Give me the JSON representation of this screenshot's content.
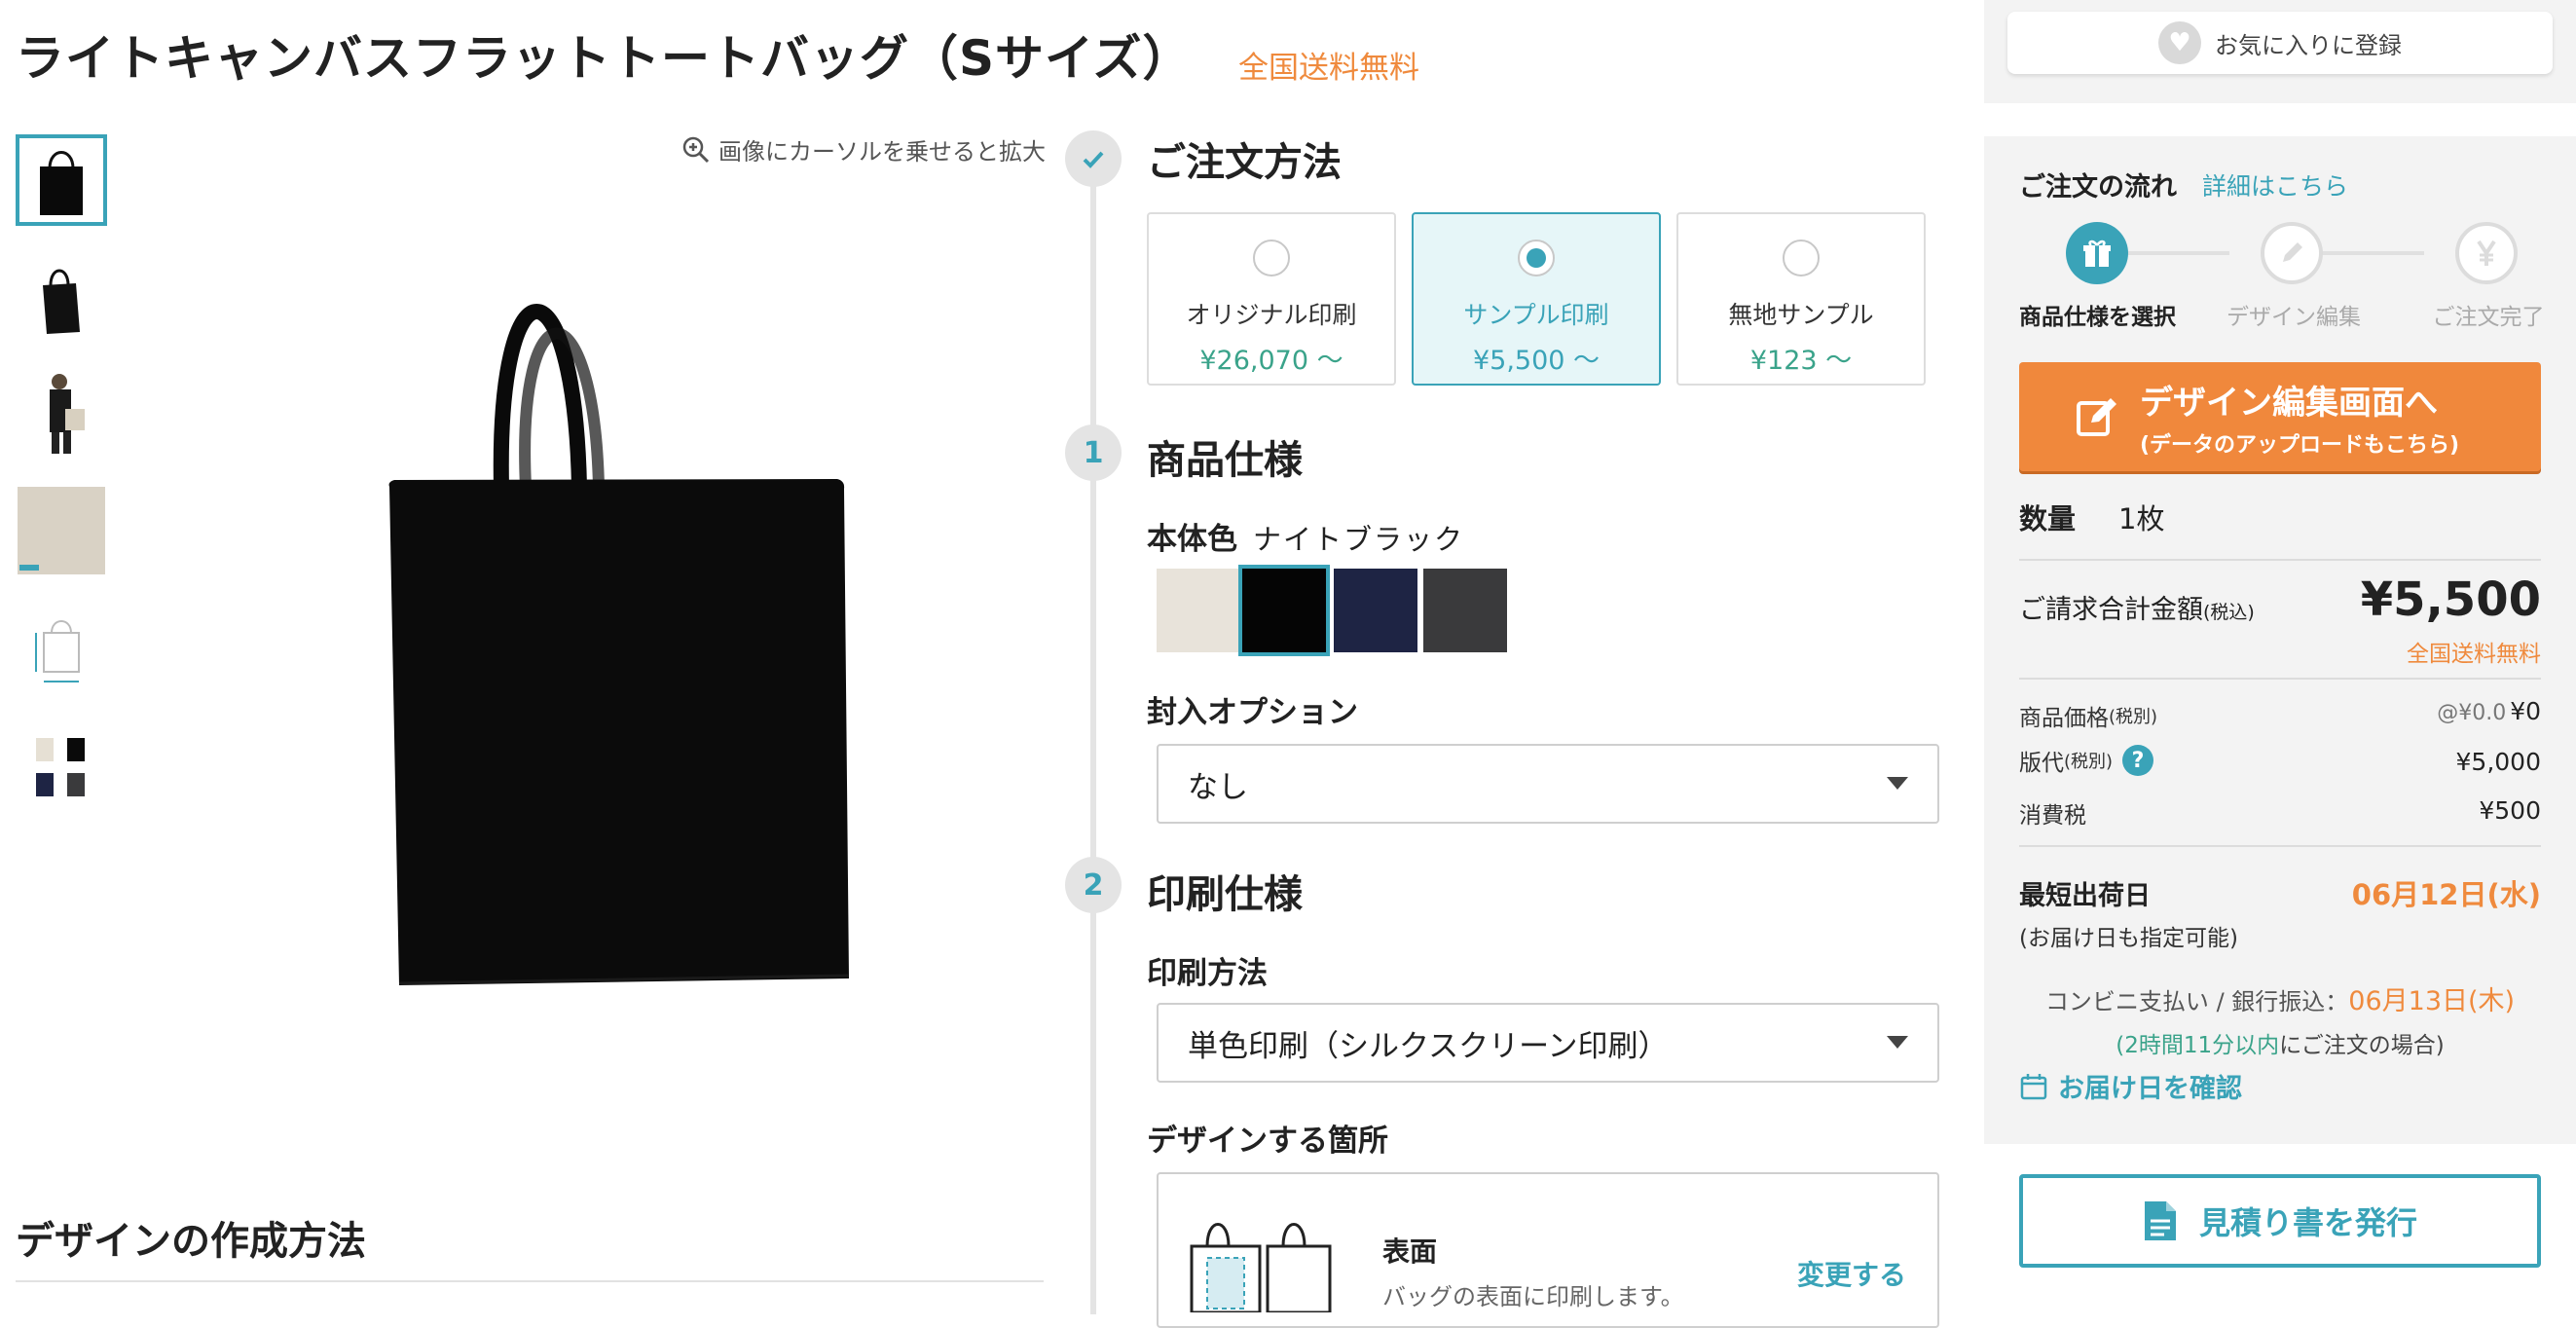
{
  "product": {
    "title": "ライトキャンバスフラットトートバッグ（Sサイズ）",
    "shipping_badge": "全国送料無料",
    "zoom_hint": "画像にカーソルを乗せると拡大",
    "design_guide_heading": "デザインの作成方法"
  },
  "order_method": {
    "title": "ご注文方法",
    "options": [
      {
        "name": "オリジナル印刷",
        "price": "¥26,070 〜",
        "selected": false
      },
      {
        "name": "サンプル印刷",
        "price": "¥5,500 〜",
        "selected": true
      },
      {
        "name": "無地サンプル",
        "price": "¥123 〜",
        "selected": false
      }
    ]
  },
  "spec": {
    "step_number": "1",
    "title": "商品仕様",
    "body_color_label": "本体色",
    "body_color_value": "ナイトブラック",
    "swatches": [
      {
        "name": "natural",
        "color": "#e8e3da",
        "selected": false
      },
      {
        "name": "night-black",
        "color": "#050505",
        "selected": true
      },
      {
        "name": "navy",
        "color": "#1e2444",
        "selected": false
      },
      {
        "name": "charcoal",
        "color": "#3a3a3c",
        "selected": false
      }
    ],
    "insert_option_label": "封入オプション",
    "insert_option_value": "なし"
  },
  "print": {
    "step_number": "2",
    "title": "印刷仕様",
    "method_label": "印刷方法",
    "method_value": "単色印刷（シルクスクリーン印刷）",
    "area_label": "デザインする箇所",
    "area_name": "表面",
    "area_desc": "バッグの表面に印刷します。",
    "area_change": "変更する"
  },
  "sidebar": {
    "favorite_label": "お気に入りに登録",
    "flow_title": "ご注文の流れ",
    "flow_link": "詳細はこちら",
    "flow_steps": [
      {
        "label": "商品仕様を選択",
        "icon": "gift-icon",
        "active": true
      },
      {
        "label": "デザイン編集",
        "icon": "pencil-icon",
        "active": false
      },
      {
        "label": "ご注文完了",
        "icon": "yen-icon",
        "active": false
      }
    ],
    "design_button_line1": "デザイン編集画面へ",
    "design_button_line2": "(データのアップロードもこちら)",
    "quantity_label": "数量",
    "quantity_value": "1枚",
    "total_label": "ご請求合計金額",
    "total_tax_note": "(税込)",
    "total_price": "¥5,500",
    "total_shipping": "全国送料無料",
    "item_price_label": "商品価格",
    "item_price_note": "(税別)",
    "item_price_unit": "@¥0.0",
    "item_price_value": "¥0",
    "plate_label": "版代",
    "plate_note": "(税別)",
    "plate_value": "¥5,000",
    "tax_label": "消費税",
    "tax_value": "¥500",
    "ship_label": "最短出荷日",
    "ship_note": "(お届け日も指定可能)",
    "ship_date": "06月12日(水)",
    "convenience_text": "コンビニ支払い / 銀行振込：",
    "convenience_date": "06月13日(木)",
    "convenience_sub_highlight": "(2時間11分以内",
    "convenience_sub_rest": "にご注文の場合)",
    "delivery_link": "お届け日を確認",
    "quote_button": "見積り書を発行"
  },
  "colors": {
    "accent": "#3aa3b8",
    "orange": "#f0883c",
    "price_green": "#3aa38a",
    "panel_bg": "#f3f3f3"
  }
}
